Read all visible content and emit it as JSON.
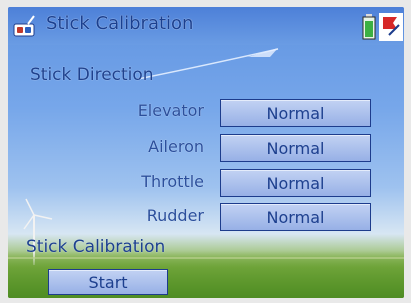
{
  "header": {
    "title": "Stick Calibration",
    "app_icon": "radio-transmitter-icon",
    "battery_icon": "battery-icon",
    "status_icon": "flag-icon"
  },
  "direction_section": {
    "heading": "Stick Direction",
    "rows": [
      {
        "label": "Elevator",
        "value": "Normal"
      },
      {
        "label": "Aileron",
        "value": "Normal"
      },
      {
        "label": "Throttle",
        "value": "Normal"
      },
      {
        "label": "Rudder",
        "value": "Normal"
      }
    ]
  },
  "calibration_section": {
    "heading": "Stick Calibration",
    "start_label": "Start"
  }
}
